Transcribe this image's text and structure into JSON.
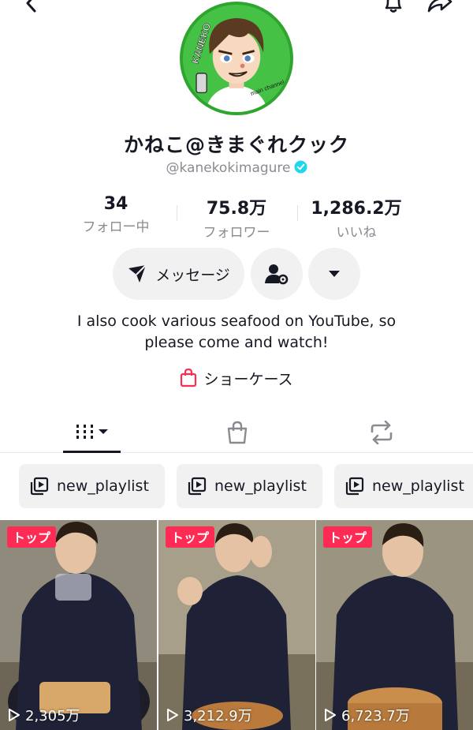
{
  "profile": {
    "display_name": "かねこ@きまぐれクック",
    "username": "@kanekokimagure",
    "avatar_text": "KANEKO",
    "avatar_subtext": "main channel"
  },
  "stats": {
    "following_count": "34",
    "following_label": "フォロー中",
    "followers_count": "75.8万",
    "followers_label": "フォロワー",
    "likes_count": "1,286.2万",
    "likes_label": "いいね"
  },
  "actions": {
    "message_label": "メッセージ"
  },
  "bio": {
    "line1": "I also cook various seafood on YouTube, so",
    "line2": "please come and watch!"
  },
  "showcase": {
    "label": "ショーケース"
  },
  "playlists": [
    {
      "label": "new_playlist"
    },
    {
      "label": "new_playlist"
    },
    {
      "label": "new_playlist"
    }
  ],
  "videos": [
    {
      "badge": "トップ",
      "views": "2,305万"
    },
    {
      "badge": "トップ",
      "views": "3,212.9万"
    },
    {
      "badge": "トップ",
      "views": "6,723.7万"
    }
  ],
  "colors": {
    "accent": "#fe2c55",
    "verified": "#20d5ec",
    "muted_text": "#8a8b91",
    "button_bg": "#f1f1f2"
  }
}
